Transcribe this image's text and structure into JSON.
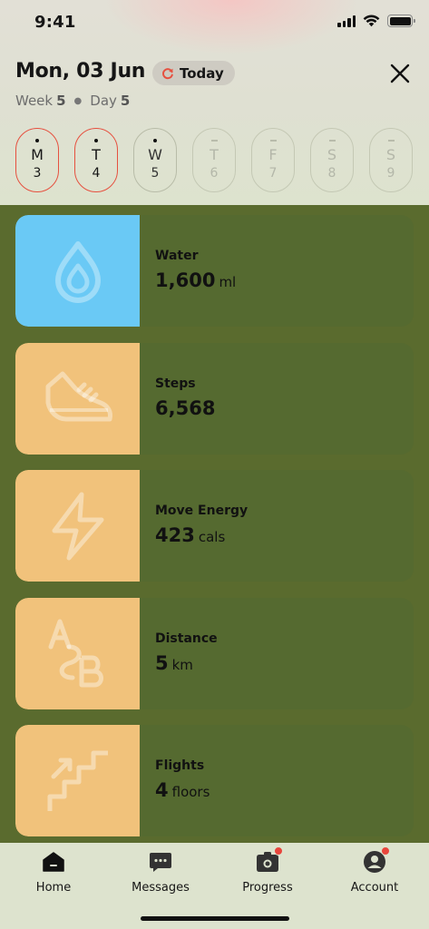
{
  "status": {
    "time": "9:41"
  },
  "header": {
    "date": "Mon, 03 Jun",
    "today_label": "Today",
    "week_label": "Week",
    "week_num": "5",
    "day_label": "Day",
    "day_num": "5"
  },
  "days": [
    {
      "letter": "M",
      "num": "3",
      "state": "active"
    },
    {
      "letter": "T",
      "num": "4",
      "state": "active"
    },
    {
      "letter": "W",
      "num": "5",
      "state": "past"
    },
    {
      "letter": "T",
      "num": "6",
      "state": "future"
    },
    {
      "letter": "F",
      "num": "7",
      "state": "future"
    },
    {
      "letter": "S",
      "num": "8",
      "state": "future"
    },
    {
      "letter": "S",
      "num": "9",
      "state": "future"
    }
  ],
  "cards": [
    {
      "label": "Water",
      "value": "1,600",
      "unit": "ml",
      "icon": "water-drop-icon",
      "color": "#6ac9f5"
    },
    {
      "label": "Steps",
      "value": "6,568",
      "unit": "",
      "icon": "sneaker-icon",
      "color": "#f1c27b"
    },
    {
      "label": "Move Energy",
      "value": "423",
      "unit": "cals",
      "icon": "lightning-icon",
      "color": "#f1c27b"
    },
    {
      "label": "Distance",
      "value": "5",
      "unit": "km",
      "icon": "a-to-b-icon",
      "color": "#f1c27b"
    },
    {
      "label": "Flights",
      "value": "4",
      "unit": "floors",
      "icon": "stairs-icon",
      "color": "#f1c27b"
    }
  ],
  "tabs": [
    {
      "label": "Home",
      "icon": "home-icon"
    },
    {
      "label": "Messages",
      "icon": "chat-icon"
    },
    {
      "label": "Progress",
      "icon": "camera-icon"
    },
    {
      "label": "Account",
      "icon": "user-icon"
    }
  ],
  "colors": {
    "accent": "#e6503f",
    "background": "#5a6b2e",
    "card": "#556a30",
    "badge": "#e8453c"
  }
}
